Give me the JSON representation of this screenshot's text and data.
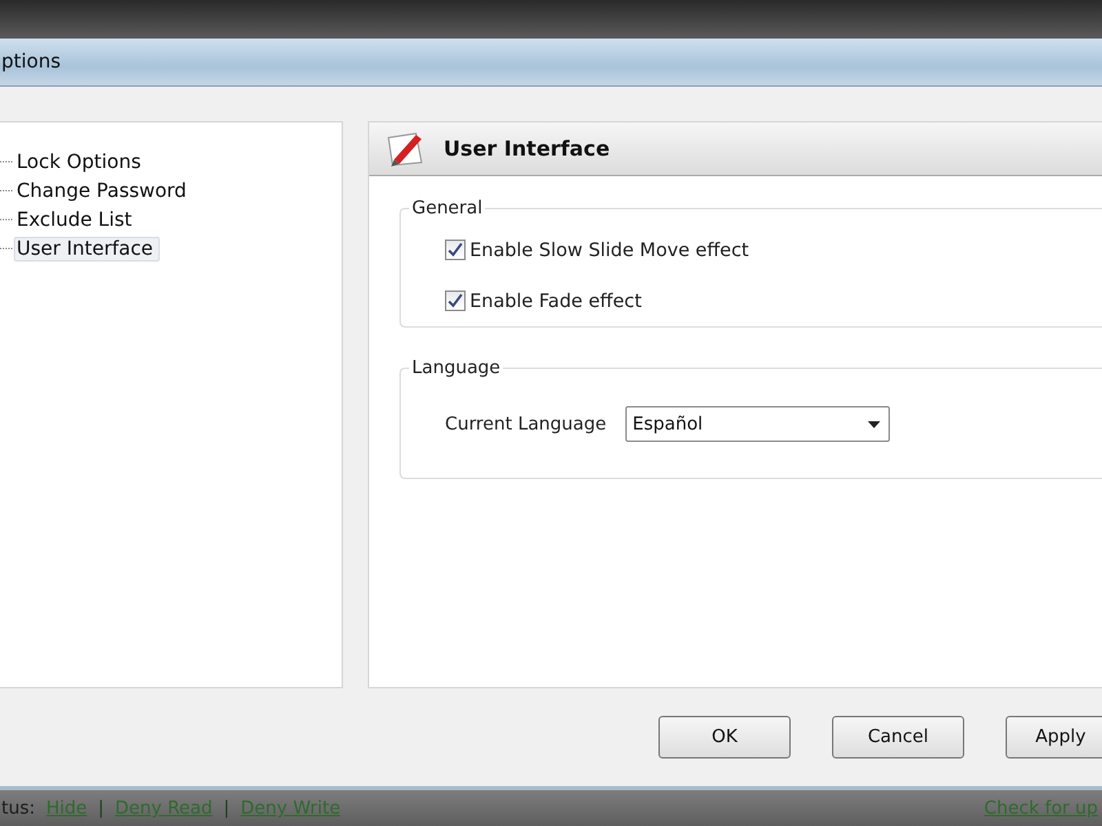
{
  "window": {
    "title": "ptions"
  },
  "tree": [
    {
      "label": "Lock Options",
      "selected": false
    },
    {
      "label": "Change Password",
      "selected": false
    },
    {
      "label": "Exclude List",
      "selected": false
    },
    {
      "label": "User Interface",
      "selected": true
    }
  ],
  "panel": {
    "title": "User Interface",
    "general": {
      "legend": "General",
      "options": [
        {
          "label": "Enable Slow Slide Move effect",
          "checked": true
        },
        {
          "label": "Enable Fade effect",
          "checked": true
        }
      ]
    },
    "language": {
      "legend": "Language",
      "label": "Current Language",
      "value": "Español"
    }
  },
  "buttons": [
    "OK",
    "Cancel",
    "Apply"
  ],
  "status_bar": {
    "label": "tus:",
    "links": [
      "Hide",
      "Deny Read",
      "Deny Write"
    ],
    "separator": "|",
    "right_link": "Check for up"
  }
}
